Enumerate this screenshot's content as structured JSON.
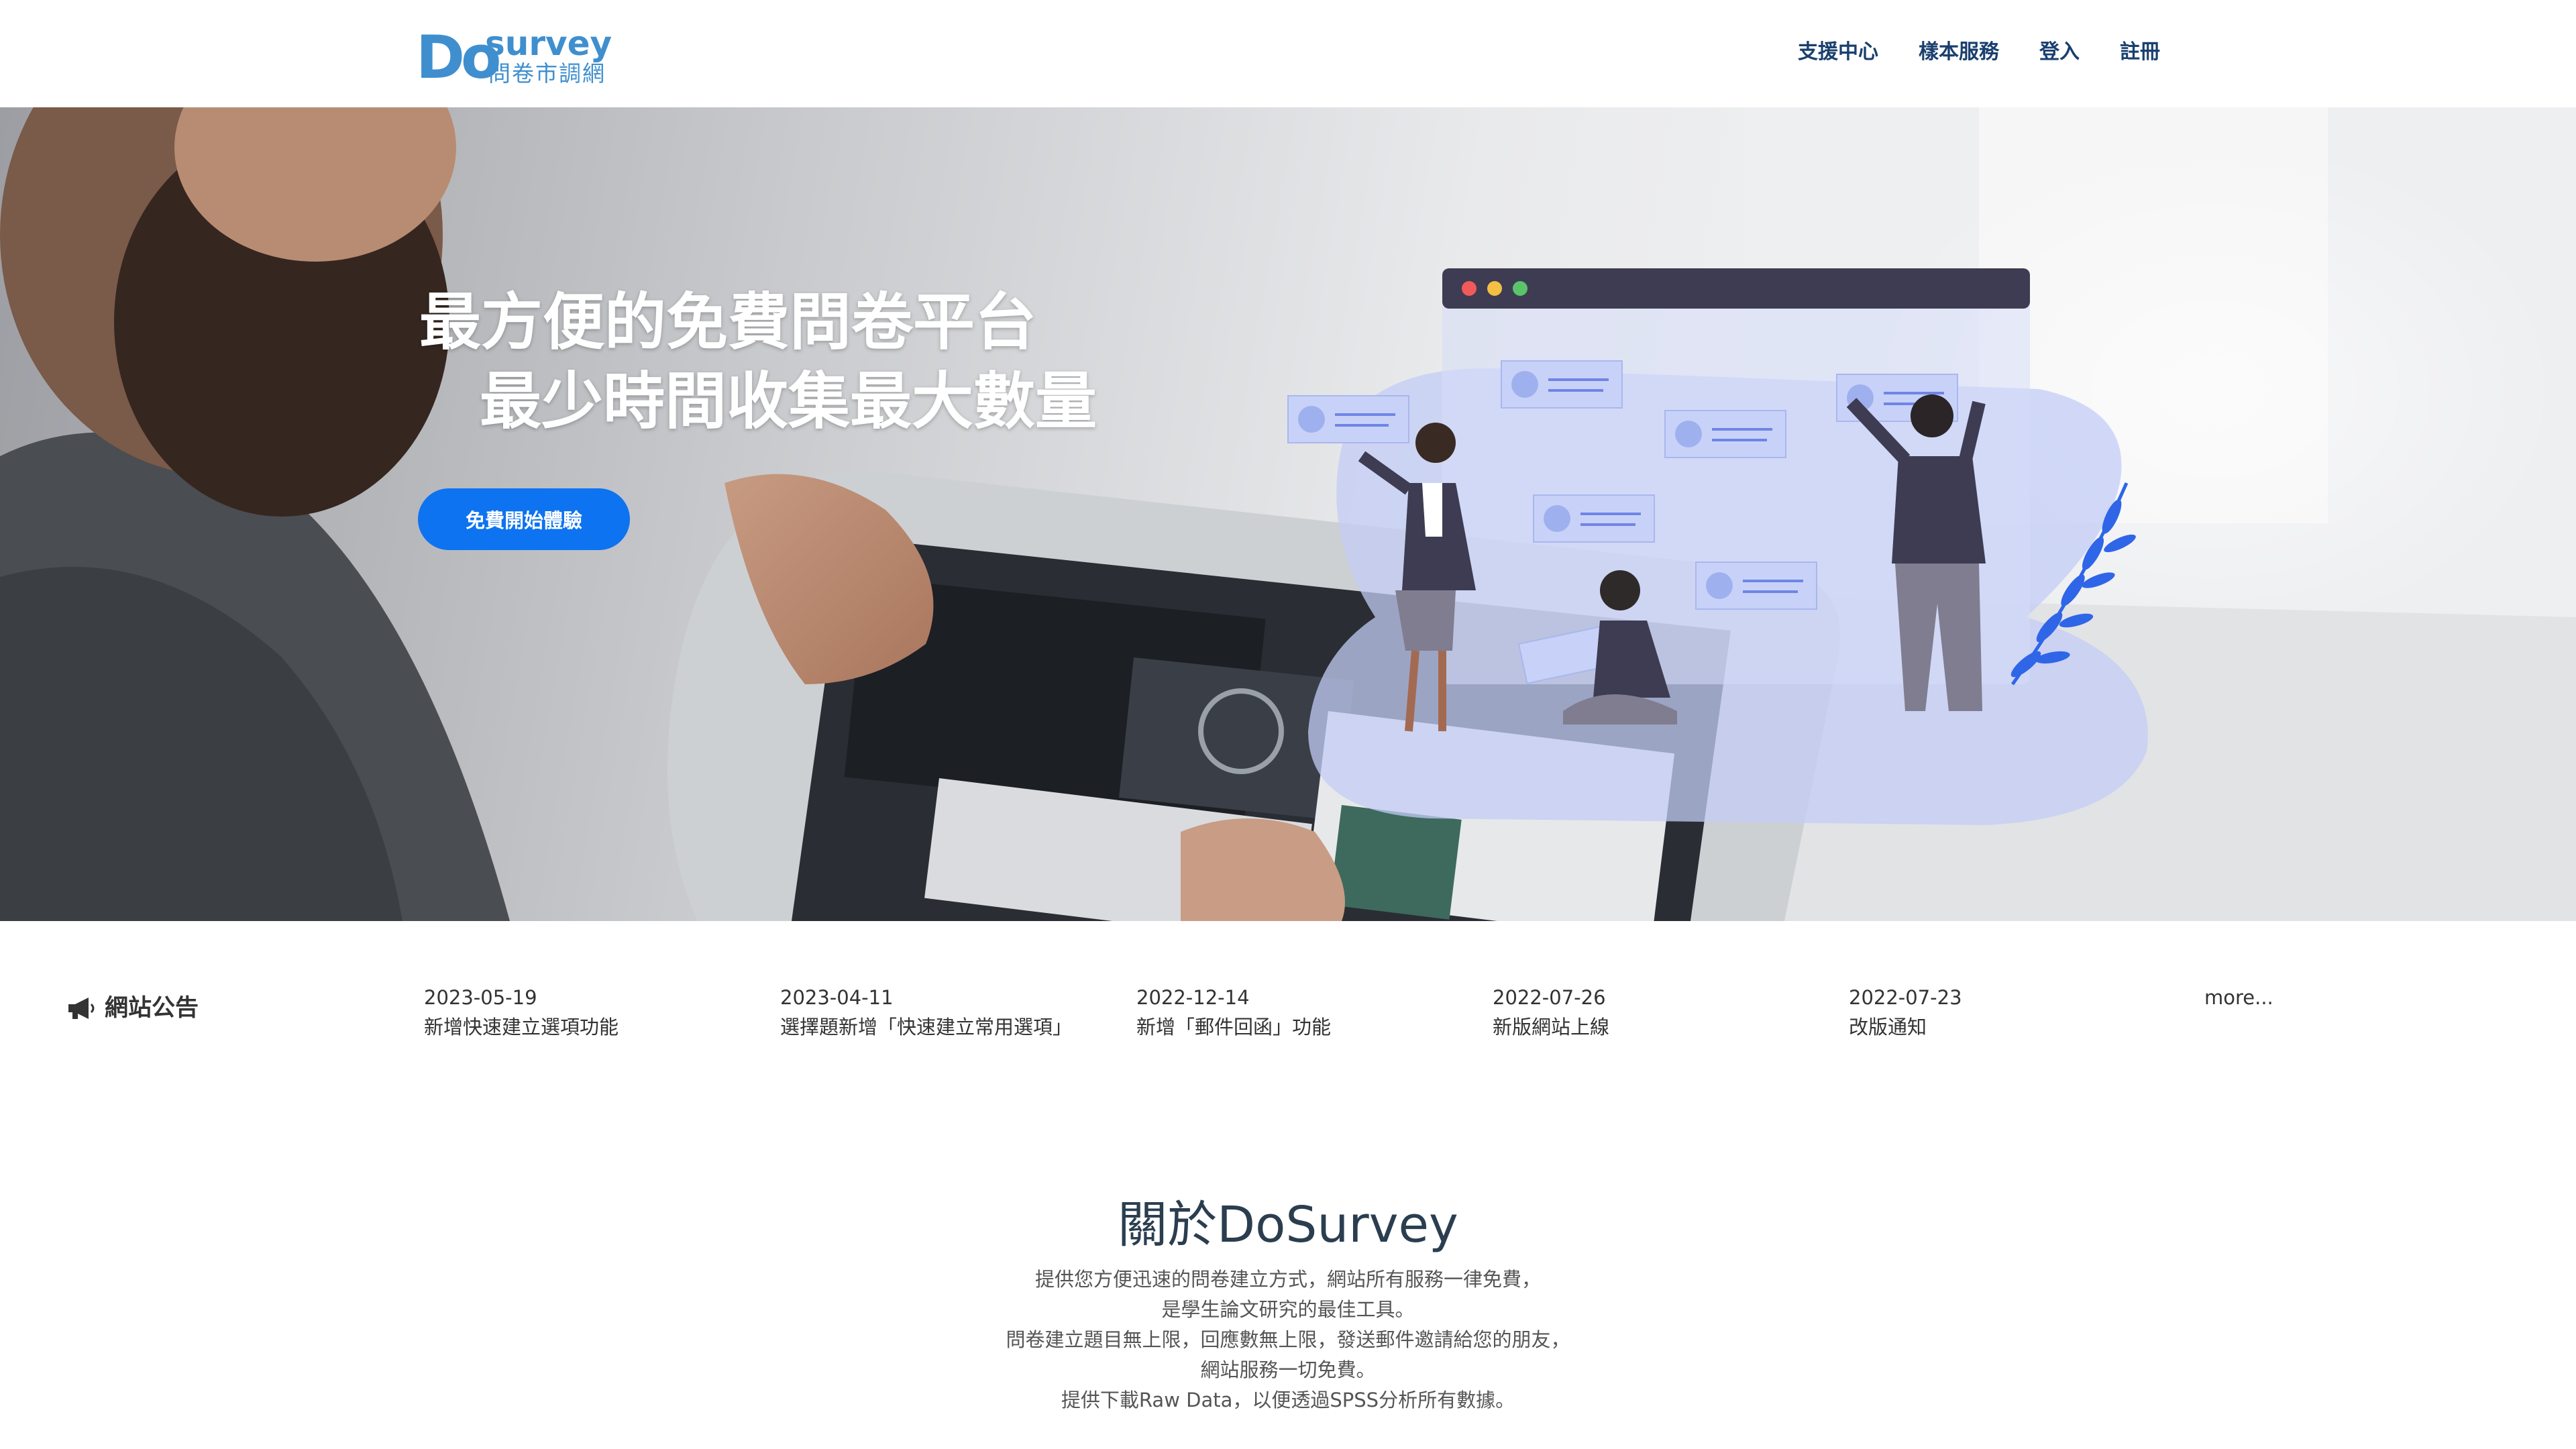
{
  "brand": {
    "logo_do": "Do",
    "logo_survey": "survey",
    "logo_sub": "問卷市調網"
  },
  "nav": {
    "items": [
      "支援中心",
      "樣本服務",
      "登入",
      "註冊"
    ]
  },
  "hero": {
    "title_line1": "最方便的免費問卷平台",
    "title_line2": "最少時間收集最大數量",
    "cta_label": "免費開始體驗"
  },
  "announcements": {
    "title": "網站公告",
    "icon": "megaphone-icon",
    "items": [
      {
        "date": "2023-05-19",
        "text": "新增快速建立選項功能"
      },
      {
        "date": "2023-04-11",
        "text": "選擇題新增「快速建立常用選項」"
      },
      {
        "date": "2022-12-14",
        "text": "新增「郵件回函」功能"
      },
      {
        "date": "2022-07-26",
        "text": "新版網站上線"
      },
      {
        "date": "2022-07-23",
        "text": "改版通知"
      }
    ],
    "more_label": "more..."
  },
  "about": {
    "title": "關於DoSurvey",
    "lines": [
      "提供您方便迅速的問卷建立方式，網站所有服務一律免費，",
      "是學生論文研究的最佳工具。",
      "問卷建立題目無上限，回應數無上限，發送郵件邀請給您的朋友，",
      "網站服務一切免費。",
      "提供下載Raw Data，以便透過SPSS分析所有數據。"
    ]
  },
  "colors": {
    "brand_blue": "#3f8fcf",
    "nav_text": "#1a3f6e",
    "cta_blue": "#0d73f0"
  }
}
